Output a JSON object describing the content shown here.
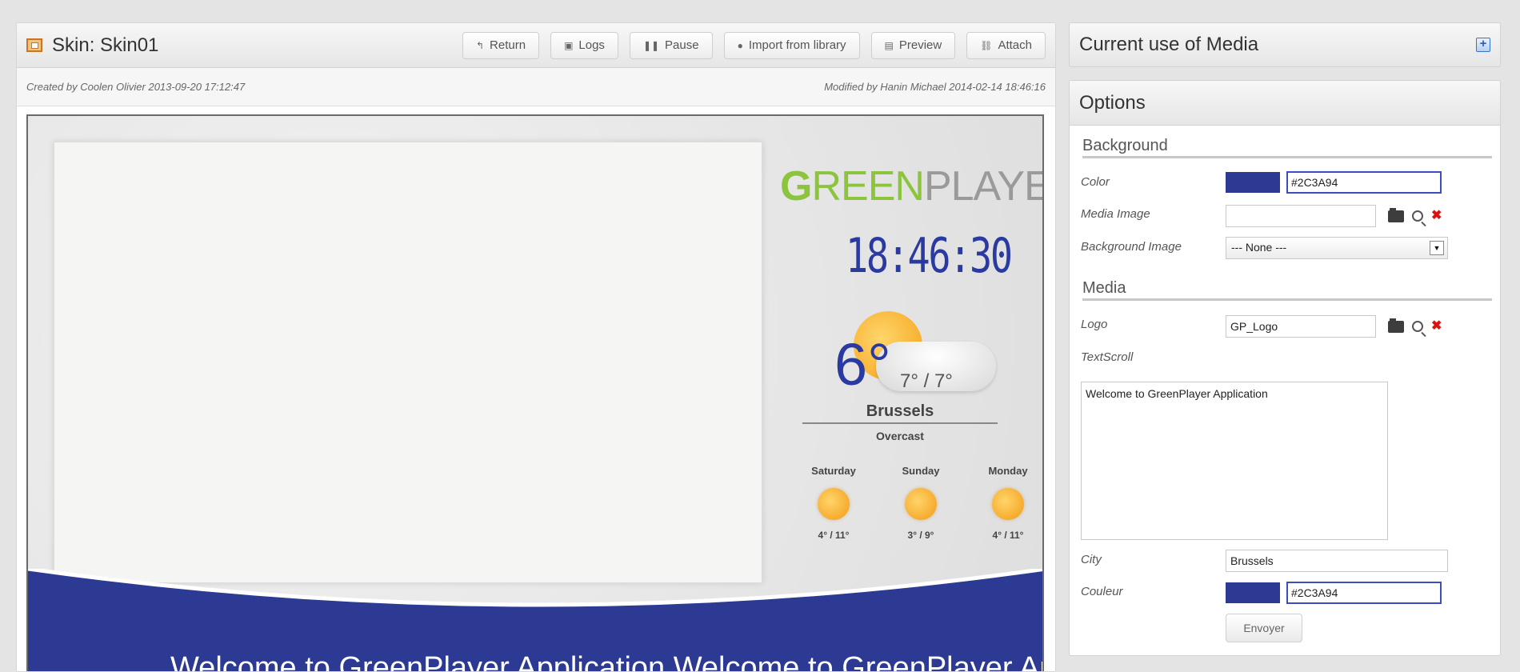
{
  "skin": {
    "title": "Skin: Skin01",
    "created": "Created by Coolen Olivier 2013-09-20 17:12:47",
    "modified": "Modified by Hanin Michael 2014-02-14 18:46:16"
  },
  "toolbar": {
    "return_label": "Return",
    "logs_label": "Logs",
    "pause_label": "Pause",
    "import_label": "Import from library",
    "preview_label": "Preview",
    "attach_label": "Attach"
  },
  "preview": {
    "logo_g": "G",
    "logo_reen": "REEN",
    "logo_player": "PLAYER",
    "clock": "18:46:30",
    "temperature": "6°",
    "temp_range": "7° / 7°",
    "city": "Brussels",
    "condition": "Overcast",
    "forecast": [
      {
        "day": "Saturday",
        "range": "4° / 11°"
      },
      {
        "day": "Sunday",
        "range": "3° / 9°"
      },
      {
        "day": "Monday",
        "range": "4° / 11°"
      }
    ],
    "ticker": "Welcome to GreenPlayer Application   Welcome to GreenPlayer Application"
  },
  "media_panel": {
    "title": "Current use of Media"
  },
  "options": {
    "title": "Options",
    "background_section": "Background",
    "color_label": "Color",
    "color_value": "#2C3A94",
    "media_image_label": "Media Image",
    "media_image_value": "",
    "bg_image_label": "Background Image",
    "bg_image_value": "--- None ---",
    "media_section": "Media",
    "logo_label": "Logo",
    "logo_value": "GP_Logo",
    "textscroll_label": "TextScroll",
    "textscroll_value": "Welcome to GreenPlayer Application",
    "city_label": "City",
    "city_value": "Brussels",
    "couleur_label": "Couleur",
    "couleur_value": "#2C3A94",
    "send_label": "Envoyer"
  },
  "colors": {
    "accent_blue": "#2C3A94",
    "logo_green": "#8DC43E"
  },
  "icons": [
    "skin-icon",
    "return-icon",
    "logs-icon",
    "pause-icon",
    "import-icon",
    "preview-icon",
    "attach-icon",
    "expand-plus-icon",
    "folder-icon",
    "search-icon",
    "delete-icon",
    "dropdown-arrow-icon"
  ]
}
